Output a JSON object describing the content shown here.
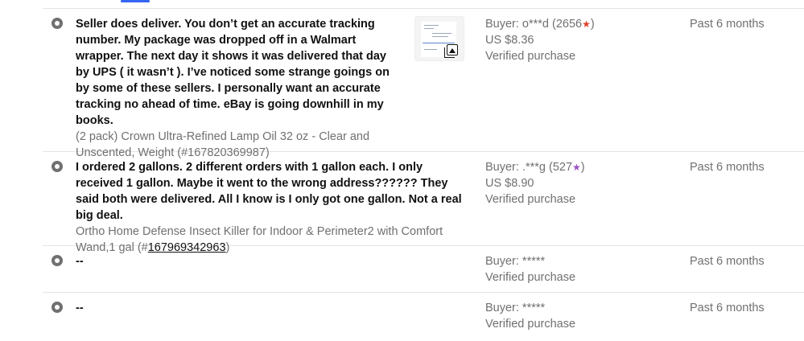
{
  "feedback": [
    {
      "comment": "Seller does deliver. You don’t get an accurate tracking number. My package was dropped off in a Walmart wrapper. The next day it shows it was delivered that day by UPS ( it wasn’t ). I’ve noticed some strange goings on by some of these sellers. I personally want an accurate tracking no ahead of time. eBay is going downhill in my books.",
      "item_text": "(2 pack) Crown Ultra-Refined Lamp Oil 32 oz - Clear and Unscented, Weight (#167820369987)",
      "item_number_link": "",
      "item_suffix": "",
      "buyer": "Buyer: o***d (2656",
      "buyer_close": ")",
      "star_color": "#e0402b",
      "price": "US $8.36",
      "verified": "Verified purchase",
      "time": "Past 6 months",
      "has_photo": true
    },
    {
      "comment": "I ordered 2 gallons. 2 different orders with 1 gallon each. I only received 1 gallon. Maybe it went to the wrong address?????? They said both were delivered. All I know is I only got one gallon. Not a real big deal.",
      "item_text": "Ortho Home Defense Insect Killer for Indoor & Perimeter2 with Comfort Wand,1 gal (#",
      "item_number_link": "167969342963",
      "item_suffix": ")",
      "buyer": "Buyer: .***g (527",
      "buyer_close": ")",
      "star_color": "#9b51c4",
      "price": "US $8.90",
      "verified": "Verified purchase",
      "time": "Past 6 months",
      "has_photo": false
    },
    {
      "comment": "--",
      "buyer": "Buyer: *****",
      "verified": "Verified purchase",
      "time": "Past 6 months"
    },
    {
      "comment": "--",
      "buyer": "Buyer: *****",
      "verified": "Verified purchase",
      "time": "Past 6 months"
    }
  ],
  "icons": {
    "rating": "neutral-rating-icon",
    "star": "feedback-star-icon",
    "photo": "photos-icon"
  }
}
